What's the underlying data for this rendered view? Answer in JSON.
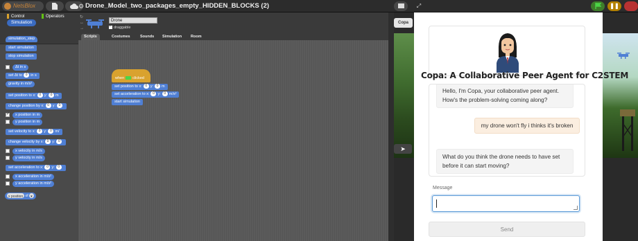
{
  "topbar": {
    "logo_text": "NetsBlox",
    "title": "Drone_Model_two_packages_empty_HIDDEN_BLOCKS (2)",
    "icons": [
      "file-icon",
      "cloud-icon",
      "gear-icon",
      "stage-size-icon",
      "fullscreen-icon",
      "green-flag-icon",
      "pause-icon",
      "stop-icon"
    ]
  },
  "palette": {
    "categories": {
      "control": "Control",
      "operators": "Operators",
      "simulation": "Simulation"
    },
    "colors": {
      "control": "#d9a22e",
      "operators": "#62c213",
      "simulation": "#3a6bc0"
    },
    "blocks": {
      "simulation_step": "simulation_step",
      "start_simulation": "start simulation",
      "stop_simulation": "stop simulation",
      "dt_reporter": "Δt in s",
      "set_dt_a": "set Δt to",
      "set_dt_val": "0",
      "set_dt_b": "in s",
      "gravity": "gravity in m/s²",
      "set_position_a": "set position to x:",
      "set_position_x": "0",
      "set_position_b": "y:",
      "set_position_y": "0",
      "set_position_c": "m",
      "change_position_a": "change position by x:",
      "change_position_x": "0",
      "change_position_b": "y:",
      "change_position_y": "0",
      "x_position": "x position in m",
      "y_position": "y position in m",
      "set_velocity_a": "set velocity to x:",
      "set_velocity_x": "0",
      "set_velocity_b": "y:",
      "set_velocity_y": "0",
      "set_velocity_c": "m/",
      "change_velocity_a": "change velocity by x:",
      "change_velocity_x": "0",
      "change_velocity_b": "y:",
      "change_velocity_y": "0",
      "x_velocity": "x velocity in m/s",
      "y_velocity": "y velocity in m/s",
      "set_accel_a": "set acceleration to x:",
      "set_accel_x": "0",
      "set_accel_b": "y:",
      "set_accel_y": "0",
      "x_accel": "x acceleration in m/s²",
      "y_accel": "y acceleration in m/s²",
      "xpos_of_a": "x position",
      "xpos_of_b": "of"
    }
  },
  "sprite": {
    "name": "Drone",
    "draggable_label": "draggable",
    "tabs": [
      "Scripts",
      "Costumes",
      "Sounds",
      "Simulation",
      "Room"
    ]
  },
  "script": {
    "when_a": "when",
    "when_b": "clicked",
    "set_position_a": "set position to x:",
    "set_position_x": "0",
    "set_position_b": "y:",
    "set_position_y": "0",
    "set_position_c": "m",
    "set_accel_a": "set acceleration to x:",
    "set_accel_x": "0",
    "set_accel_b": "y:",
    "set_accel_y": "0",
    "set_accel_c": "m/s²",
    "start_simulation": "start simulation"
  },
  "stage": {
    "tab_label": "Copa",
    "arrow": "➤"
  },
  "chat": {
    "title": "Copa: A Collaborative Peer Agent for C2STEM",
    "messages": [
      {
        "role": "agent",
        "text": "Hello, I'm Copa, your collaborative peer agent. How's the problem-solving coming along?"
      },
      {
        "role": "user",
        "text": "my drone won't fly i thinks it's broken"
      },
      {
        "role": "agent",
        "text": "What do you think the drone needs to have set before it can start moving?"
      }
    ],
    "message_label": "Message",
    "message_value": "",
    "send_label": "Send"
  }
}
